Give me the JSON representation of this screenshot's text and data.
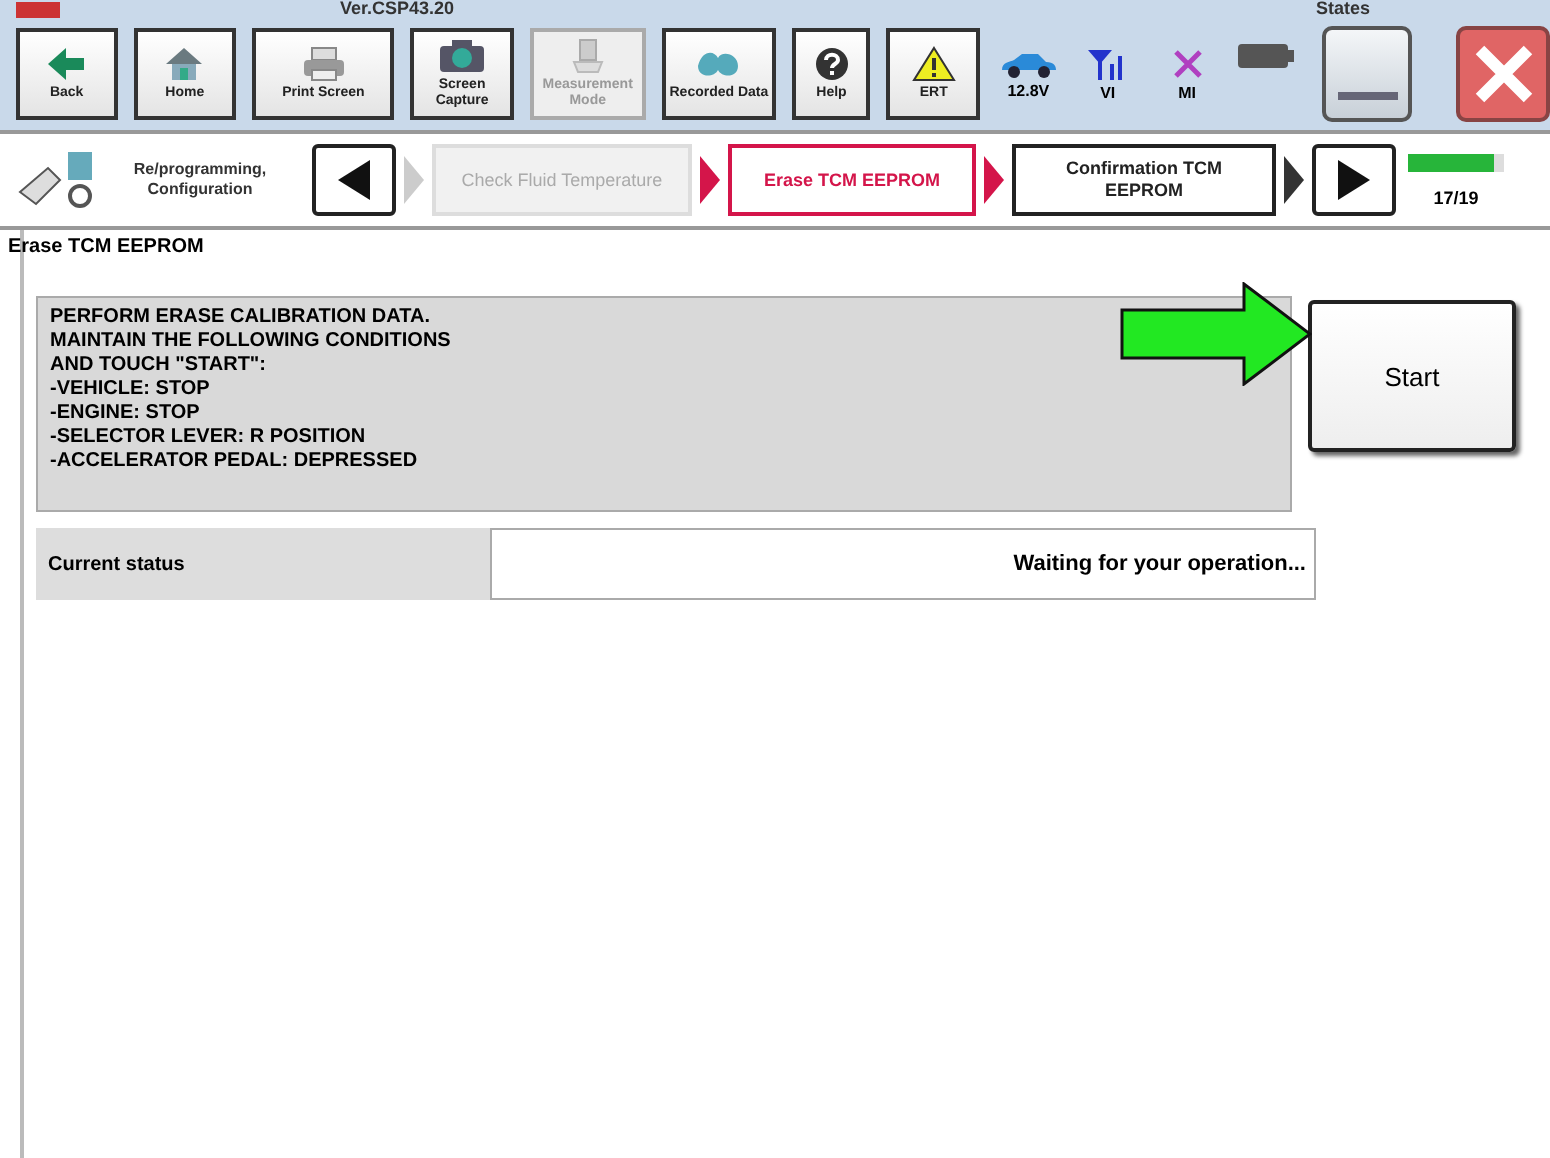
{
  "title_bar": {
    "version": "Ver.CSP43.20",
    "states_label": "States"
  },
  "toolbar": [
    {
      "label": "Back",
      "disabled": false
    },
    {
      "label": "Home",
      "disabled": false
    },
    {
      "label": "Print Screen",
      "disabled": false
    },
    {
      "label": "Screen Capture",
      "disabled": false
    },
    {
      "label": "Measurement Mode",
      "disabled": true
    },
    {
      "label": "Recorded Data",
      "disabled": false
    },
    {
      "label": "Help",
      "disabled": false
    },
    {
      "label": "ERT",
      "disabled": false
    }
  ],
  "status_icons": [
    {
      "kind": "car",
      "label": "12.8V"
    },
    {
      "kind": "signal",
      "label": "VI"
    },
    {
      "kind": "cross",
      "label": "MI"
    },
    {
      "kind": "battery"
    }
  ],
  "steps_bar": {
    "section": "Re/programming, Configuration",
    "steps": [
      {
        "label": "Check Fluid Temperature",
        "selected": false,
        "disabled": true
      },
      {
        "label": "Erase TCM EEPROM",
        "selected": true,
        "disabled": false
      },
      {
        "label": "Confirmation TCM EEPROM",
        "selected": false,
        "disabled": false
      }
    ],
    "progress": {
      "level": 0.89,
      "label": "17/19"
    }
  },
  "page_title": "Erase TCM EEPROM",
  "instructions": [
    "PERFORM ERASE CALIBRATION DATA.",
    "MAINTAIN THE FOLLOWING CONDITIONS",
    "AND TOUCH \"START\":",
    "-VEHICLE: STOP",
    "-ENGINE: STOP",
    "-SELECTOR LEVER: R POSITION",
    "-ACCELERATOR PEDAL: DEPRESSED"
  ],
  "start_button": "Start",
  "status": {
    "label": "Current status",
    "value": "Waiting for your operation..."
  }
}
